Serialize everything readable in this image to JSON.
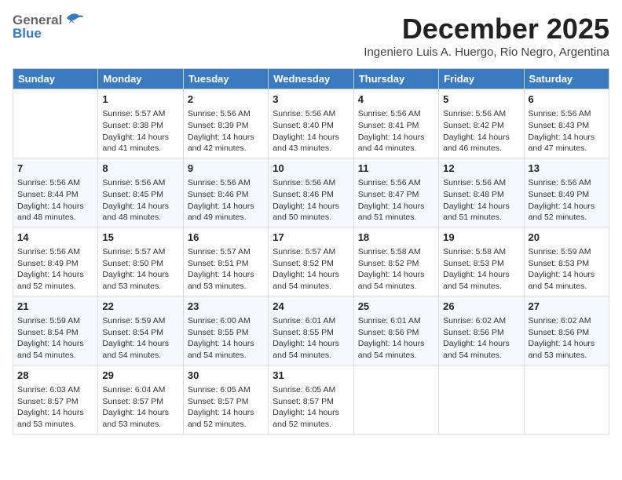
{
  "header": {
    "logo_general": "General",
    "logo_blue": "Blue",
    "month_title": "December 2025",
    "subtitle": "Ingeniero Luis A. Huergo, Rio Negro, Argentina"
  },
  "weekdays": [
    "Sunday",
    "Monday",
    "Tuesday",
    "Wednesday",
    "Thursday",
    "Friday",
    "Saturday"
  ],
  "weeks": [
    [
      {
        "day": "",
        "content": ""
      },
      {
        "day": "1",
        "content": "Sunrise: 5:57 AM\nSunset: 8:38 PM\nDaylight: 14 hours\nand 41 minutes."
      },
      {
        "day": "2",
        "content": "Sunrise: 5:56 AM\nSunset: 8:39 PM\nDaylight: 14 hours\nand 42 minutes."
      },
      {
        "day": "3",
        "content": "Sunrise: 5:56 AM\nSunset: 8:40 PM\nDaylight: 14 hours\nand 43 minutes."
      },
      {
        "day": "4",
        "content": "Sunrise: 5:56 AM\nSunset: 8:41 PM\nDaylight: 14 hours\nand 44 minutes."
      },
      {
        "day": "5",
        "content": "Sunrise: 5:56 AM\nSunset: 8:42 PM\nDaylight: 14 hours\nand 46 minutes."
      },
      {
        "day": "6",
        "content": "Sunrise: 5:56 AM\nSunset: 8:43 PM\nDaylight: 14 hours\nand 47 minutes."
      }
    ],
    [
      {
        "day": "7",
        "content": "Sunrise: 5:56 AM\nSunset: 8:44 PM\nDaylight: 14 hours\nand 48 minutes."
      },
      {
        "day": "8",
        "content": "Sunrise: 5:56 AM\nSunset: 8:45 PM\nDaylight: 14 hours\nand 48 minutes."
      },
      {
        "day": "9",
        "content": "Sunrise: 5:56 AM\nSunset: 8:46 PM\nDaylight: 14 hours\nand 49 minutes."
      },
      {
        "day": "10",
        "content": "Sunrise: 5:56 AM\nSunset: 8:46 PM\nDaylight: 14 hours\nand 50 minutes."
      },
      {
        "day": "11",
        "content": "Sunrise: 5:56 AM\nSunset: 8:47 PM\nDaylight: 14 hours\nand 51 minutes."
      },
      {
        "day": "12",
        "content": "Sunrise: 5:56 AM\nSunset: 8:48 PM\nDaylight: 14 hours\nand 51 minutes."
      },
      {
        "day": "13",
        "content": "Sunrise: 5:56 AM\nSunset: 8:49 PM\nDaylight: 14 hours\nand 52 minutes."
      }
    ],
    [
      {
        "day": "14",
        "content": "Sunrise: 5:56 AM\nSunset: 8:49 PM\nDaylight: 14 hours\nand 52 minutes."
      },
      {
        "day": "15",
        "content": "Sunrise: 5:57 AM\nSunset: 8:50 PM\nDaylight: 14 hours\nand 53 minutes."
      },
      {
        "day": "16",
        "content": "Sunrise: 5:57 AM\nSunset: 8:51 PM\nDaylight: 14 hours\nand 53 minutes."
      },
      {
        "day": "17",
        "content": "Sunrise: 5:57 AM\nSunset: 8:52 PM\nDaylight: 14 hours\nand 54 minutes."
      },
      {
        "day": "18",
        "content": "Sunrise: 5:58 AM\nSunset: 8:52 PM\nDaylight: 14 hours\nand 54 minutes."
      },
      {
        "day": "19",
        "content": "Sunrise: 5:58 AM\nSunset: 8:53 PM\nDaylight: 14 hours\nand 54 minutes."
      },
      {
        "day": "20",
        "content": "Sunrise: 5:59 AM\nSunset: 8:53 PM\nDaylight: 14 hours\nand 54 minutes."
      }
    ],
    [
      {
        "day": "21",
        "content": "Sunrise: 5:59 AM\nSunset: 8:54 PM\nDaylight: 14 hours\nand 54 minutes."
      },
      {
        "day": "22",
        "content": "Sunrise: 5:59 AM\nSunset: 8:54 PM\nDaylight: 14 hours\nand 54 minutes."
      },
      {
        "day": "23",
        "content": "Sunrise: 6:00 AM\nSunset: 8:55 PM\nDaylight: 14 hours\nand 54 minutes."
      },
      {
        "day": "24",
        "content": "Sunrise: 6:01 AM\nSunset: 8:55 PM\nDaylight: 14 hours\nand 54 minutes."
      },
      {
        "day": "25",
        "content": "Sunrise: 6:01 AM\nSunset: 8:56 PM\nDaylight: 14 hours\nand 54 minutes."
      },
      {
        "day": "26",
        "content": "Sunrise: 6:02 AM\nSunset: 8:56 PM\nDaylight: 14 hours\nand 54 minutes."
      },
      {
        "day": "27",
        "content": "Sunrise: 6:02 AM\nSunset: 8:56 PM\nDaylight: 14 hours\nand 53 minutes."
      }
    ],
    [
      {
        "day": "28",
        "content": "Sunrise: 6:03 AM\nSunset: 8:57 PM\nDaylight: 14 hours\nand 53 minutes."
      },
      {
        "day": "29",
        "content": "Sunrise: 6:04 AM\nSunset: 8:57 PM\nDaylight: 14 hours\nand 53 minutes."
      },
      {
        "day": "30",
        "content": "Sunrise: 6:05 AM\nSunset: 8:57 PM\nDaylight: 14 hours\nand 52 minutes."
      },
      {
        "day": "31",
        "content": "Sunrise: 6:05 AM\nSunset: 8:57 PM\nDaylight: 14 hours\nand 52 minutes."
      },
      {
        "day": "",
        "content": ""
      },
      {
        "day": "",
        "content": ""
      },
      {
        "day": "",
        "content": ""
      }
    ]
  ]
}
